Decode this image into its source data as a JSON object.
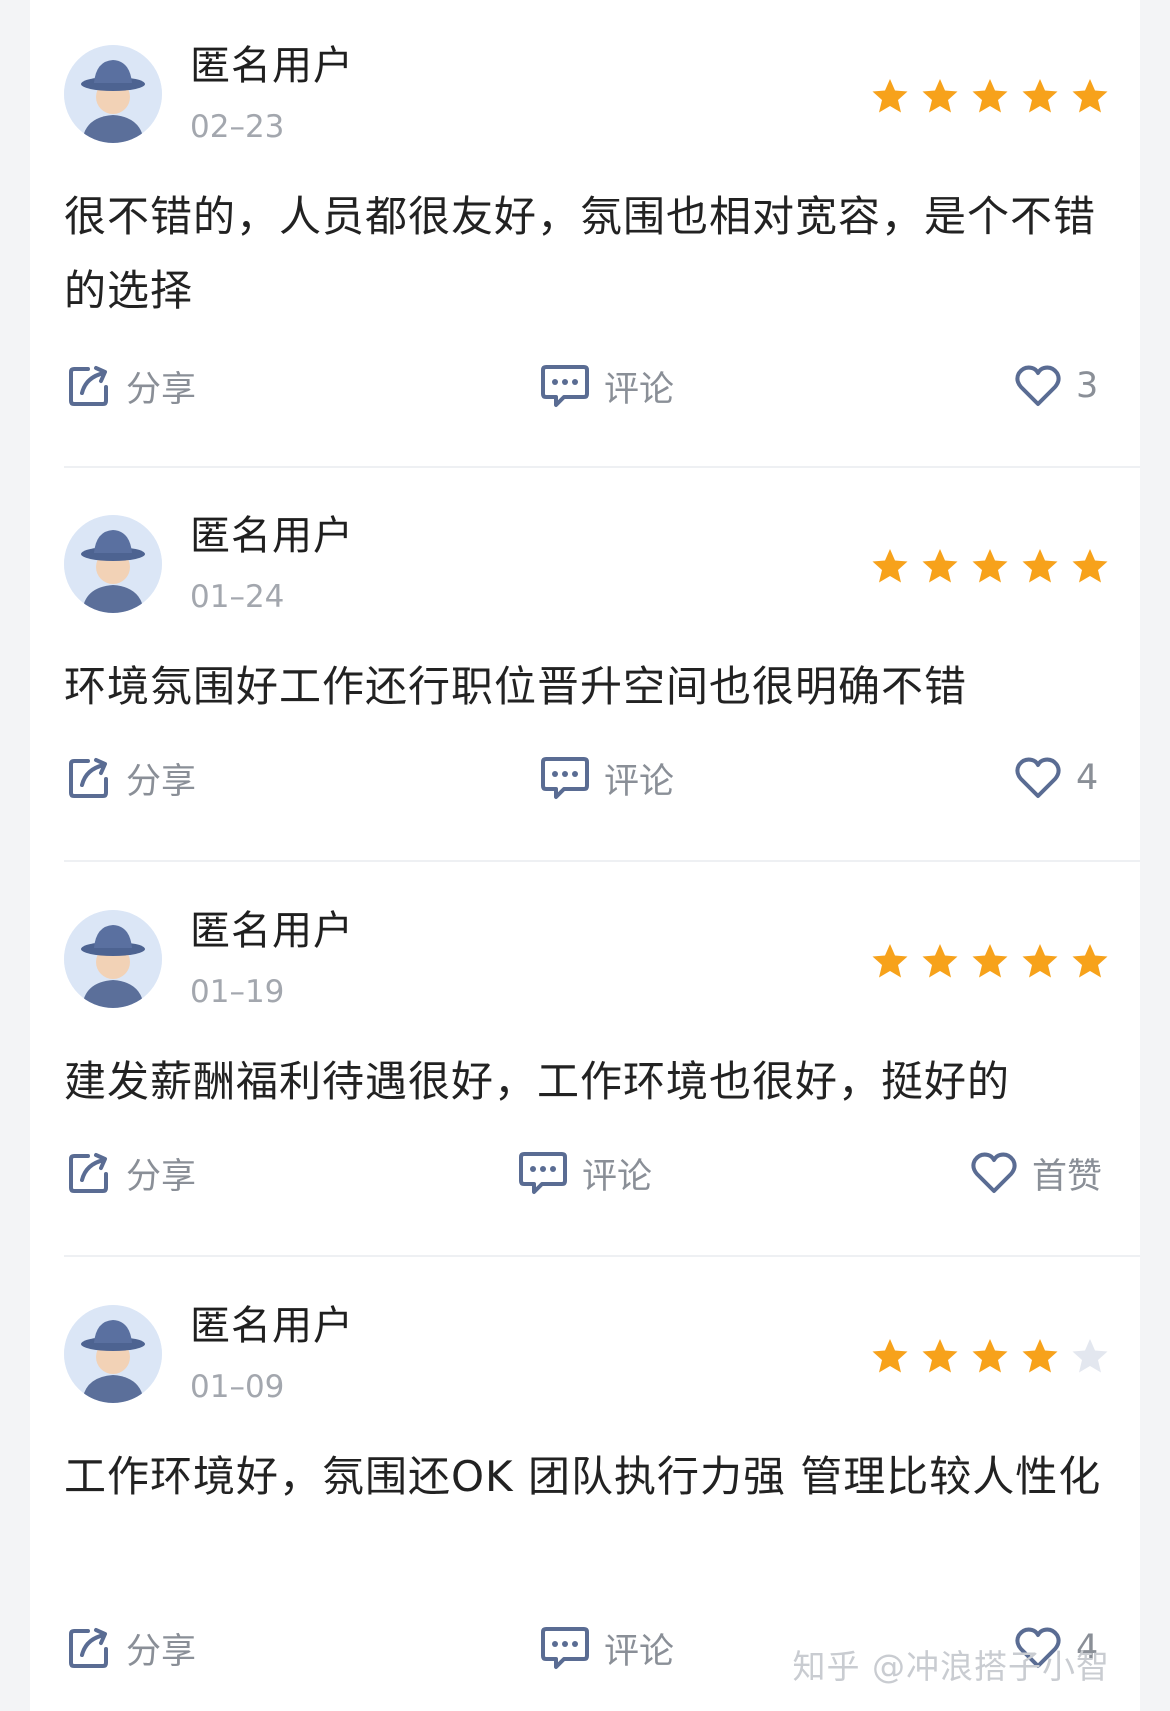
{
  "reviews": [
    {
      "user_name": "匿名用户",
      "date": "02–23",
      "rating": 5,
      "text": "很不错的，人员都很友好，氛围也相对宽容，是个不错的选择",
      "share_label": "分享",
      "comment_label": "评论",
      "like_label": "3"
    },
    {
      "user_name": "匿名用户",
      "date": "01–24",
      "rating": 5,
      "text": "环境氛围好工作还行职位晋升空间也很明确不错",
      "share_label": "分享",
      "comment_label": "评论",
      "like_label": "4"
    },
    {
      "user_name": "匿名用户",
      "date": "01–19",
      "rating": 5,
      "text": "建发薪酬福利待遇很好，工作环境也很好，挺好的",
      "share_label": "分享",
      "comment_label": "评论",
      "like_label": "首赞"
    },
    {
      "user_name": "匿名用户",
      "date": "01–09",
      "rating": 4,
      "text": "工作环境好，氛围还OK 团队执行力强  管理比较人性化",
      "share_label": "分享",
      "comment_label": "评论",
      "like_label": "4"
    }
  ],
  "watermark": "知乎 @冲浪搭子小智",
  "icons": {
    "share": "share-icon",
    "comment": "comment-icon",
    "like": "heart-icon",
    "star": "star-icon",
    "avatar": "anonymous-avatar-icon"
  },
  "colors": {
    "star_filled": "#f7a21b",
    "star_empty": "#e3e7ef",
    "icon_stroke": "#5a6c93",
    "meta_text": "#a3a7ae"
  }
}
